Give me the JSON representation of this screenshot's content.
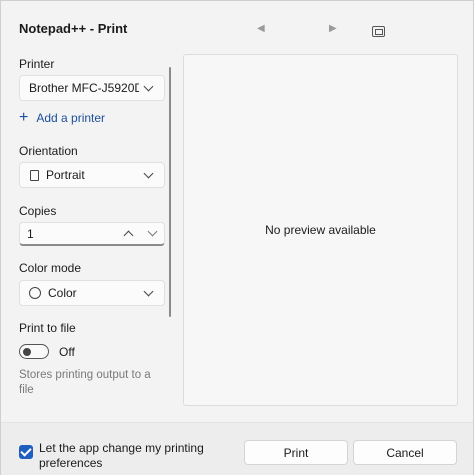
{
  "window": {
    "title": "Notepad++ - Print"
  },
  "nav": {
    "prev_glyph": "◀",
    "next_glyph": "▶",
    "fit_icon": "fit-page-icon"
  },
  "settings": {
    "printer_label": "Printer",
    "printer_value": "Brother MFC-J5920DW",
    "add_printer": "Add a printer",
    "orientation_label": "Orientation",
    "orientation_value": "Portrait",
    "copies_label": "Copies",
    "copies_value": "1",
    "color_label": "Color mode",
    "color_value": "Color",
    "print_to_file_label": "Print to file",
    "print_to_file_state": "Off",
    "print_to_file_hint": "Stores printing output to a file"
  },
  "preview": {
    "message": "No preview available"
  },
  "footer": {
    "checkbox_label": "Let the app change my printing preferences",
    "checkbox_checked": true,
    "print_button": "Print",
    "cancel_button": "Cancel"
  },
  "colors": {
    "accent": "#1f5fbf",
    "link": "#1b4f9c"
  }
}
